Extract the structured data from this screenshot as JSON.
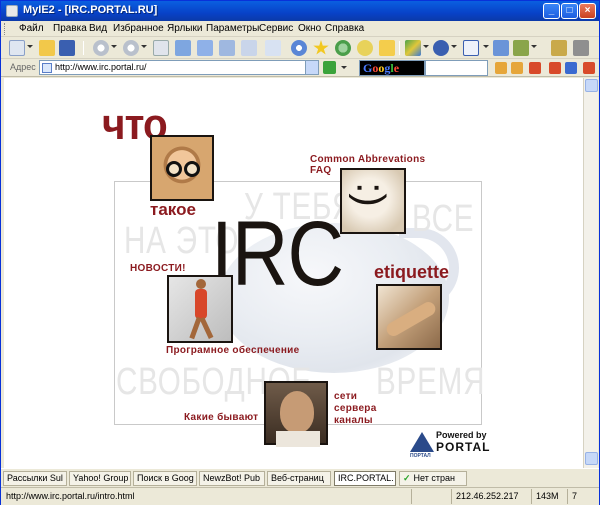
{
  "window": {
    "title": "MyIE2 - [IRC.PORTAL.RU]",
    "minimize": "_",
    "maximize": "□",
    "close": "×"
  },
  "menu": [
    "Файл",
    "Правка",
    "Вид",
    "Избранное",
    "Ярлыки",
    "Параметры",
    "Сервис",
    "Окно",
    "Справка"
  ],
  "address": {
    "label": "Адрес",
    "url": "http://www.irc.portal.ru/"
  },
  "search": {
    "brand_letters": [
      "G",
      "o",
      "o",
      "g",
      "l",
      "e"
    ],
    "brand_colors": [
      "#4a7bff",
      "#ff4a3a",
      "#ffcc22",
      "#4a7bff",
      "#3bbd3b",
      "#ff4a3a"
    ]
  },
  "site": {
    "chto": "что",
    "takoe": "такое",
    "irc": "IRC",
    "common_abbr": "Common Abbrevations",
    "faq": "FAQ",
    "smiley": ":)",
    "news": "НОВОСТИ!",
    "etiquette": "etiquette",
    "software": "Програмное обеспечение",
    "networks": "сети",
    "servers": "сервера",
    "channels": "каналы",
    "what_kinds": "Какие бывают",
    "ghost_1": "У ТЕБЯ",
    "ghost_2": "НА ЭТО",
    "ghost_3": "ВСЕ",
    "ghost_4": "СВОБОДНОЕ",
    "ghost_5": "ВРЕМЯ",
    "powered_by": "Powered by",
    "portal": "PORTAL",
    "portal_logo_text": "ПОРТАЛ"
  },
  "tabs": [
    {
      "label": "Рассылки Sul",
      "active": false
    },
    {
      "label": "Yahoo! Group",
      "active": false
    },
    {
      "label": "Поиск в Goog",
      "active": false
    },
    {
      "label": "NewzBot! Pub",
      "active": false
    },
    {
      "label": "Веб-страниц",
      "active": false
    },
    {
      "label": "IRC.PORTAL.",
      "active": true
    },
    {
      "label": "Нет стран",
      "active": false
    }
  ],
  "status": {
    "url": "http://www.irc.portal.ru/intro.html",
    "ip": "212.46.252.217",
    "memory": "143M",
    "count": "7"
  },
  "colors": {
    "accent": "#8b1a1f",
    "titlebar": "#0842c8"
  }
}
